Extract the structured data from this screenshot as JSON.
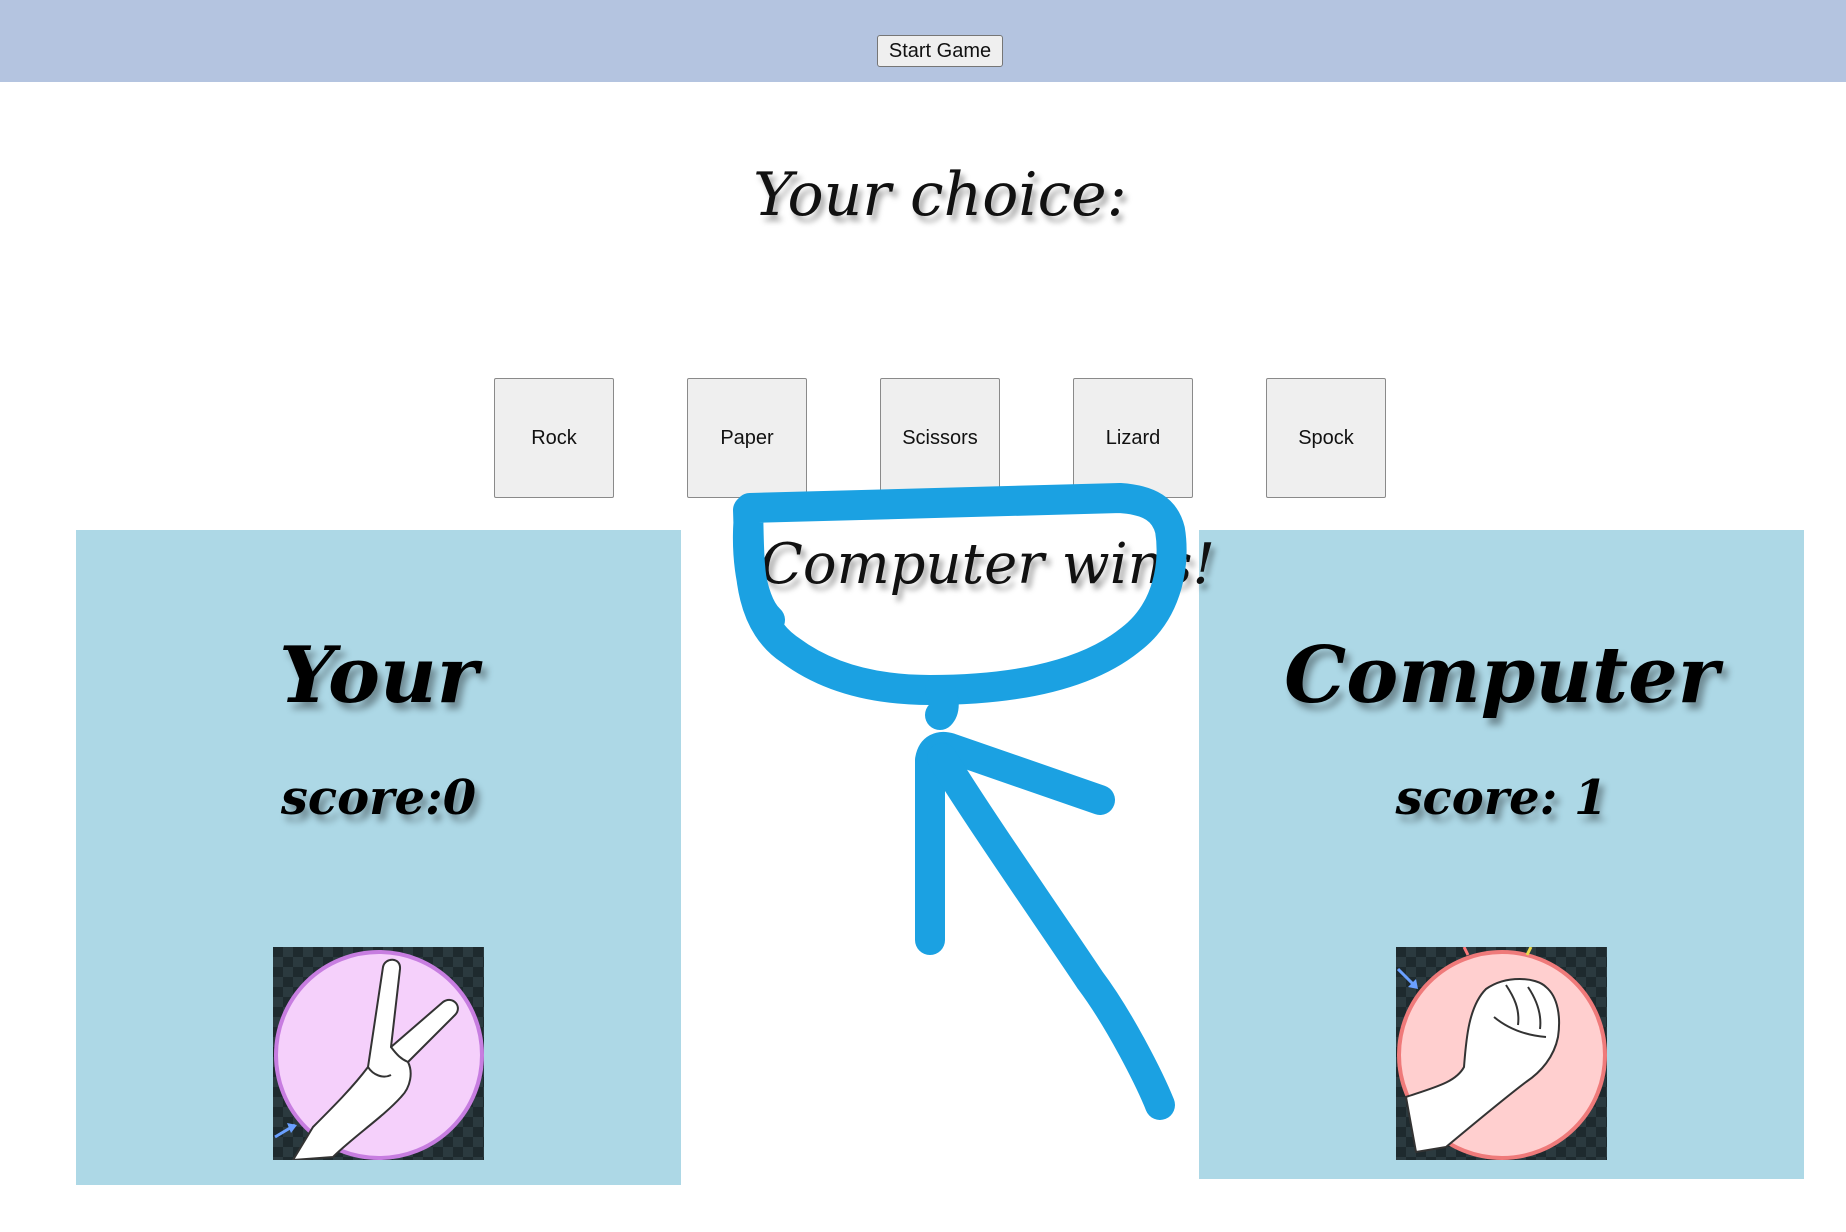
{
  "header": {
    "start_button_label": "Start Game"
  },
  "prompt": {
    "title": "Your choice:"
  },
  "choices": [
    {
      "label": "Rock"
    },
    {
      "label": "Paper"
    },
    {
      "label": "Scissors"
    },
    {
      "label": "Lizard"
    },
    {
      "label": "Spock"
    }
  ],
  "result": {
    "text": "Computer wins!"
  },
  "player": {
    "title": "Your",
    "score_text": "score:0",
    "hand_icon": "scissors-hand-icon",
    "circle_color": "#f5d0fb"
  },
  "computer": {
    "title": "Computer",
    "score_text": "score: 1",
    "hand_icon": "rock-fist-icon",
    "circle_color": "#ffcfcf"
  },
  "colors": {
    "top_bar": "#b4c4e0",
    "panel": "#add8e6",
    "annotation_stroke": "#1ba1e2"
  }
}
